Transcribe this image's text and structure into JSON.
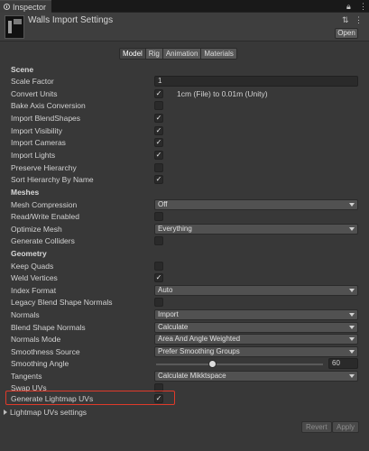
{
  "tab": {
    "label": "Inspector"
  },
  "header": {
    "title": "Walls Import Settings",
    "open_label": "Open"
  },
  "subtabs": [
    "Model",
    "Rig",
    "Animation",
    "Materials"
  ],
  "active_subtab": "Model",
  "scene": {
    "title": "Scene",
    "scale_factor_label": "Scale Factor",
    "scale_factor_value": "1",
    "convert_units_label": "Convert Units",
    "convert_units_checked": true,
    "convert_units_text": "1cm (File) to 0.01m (Unity)",
    "bake_axis_label": "Bake Axis Conversion",
    "bake_axis_checked": false,
    "import_blendshapes_label": "Import BlendShapes",
    "import_blendshapes_checked": true,
    "import_visibility_label": "Import Visibility",
    "import_visibility_checked": true,
    "import_cameras_label": "Import Cameras",
    "import_cameras_checked": true,
    "import_lights_label": "Import Lights",
    "import_lights_checked": true,
    "preserve_hierarchy_label": "Preserve Hierarchy",
    "preserve_hierarchy_checked": false,
    "sort_hierarchy_label": "Sort Hierarchy By Name",
    "sort_hierarchy_checked": true
  },
  "meshes": {
    "title": "Meshes",
    "mesh_compression_label": "Mesh Compression",
    "mesh_compression_value": "Off",
    "read_write_label": "Read/Write Enabled",
    "read_write_checked": false,
    "optimize_mesh_label": "Optimize Mesh",
    "optimize_mesh_value": "Everything",
    "generate_colliders_label": "Generate Colliders",
    "generate_colliders_checked": false
  },
  "geometry": {
    "title": "Geometry",
    "keep_quads_label": "Keep Quads",
    "keep_quads_checked": false,
    "weld_vertices_label": "Weld Vertices",
    "weld_vertices_checked": true,
    "index_format_label": "Index Format",
    "index_format_value": "Auto",
    "legacy_blend_label": "Legacy Blend Shape Normals",
    "legacy_blend_checked": false,
    "normals_label": "Normals",
    "normals_value": "Import",
    "blend_shape_normals_label": "Blend Shape Normals",
    "blend_shape_normals_value": "Calculate",
    "normals_mode_label": "Normals Mode",
    "normals_mode_value": "Area And Angle Weighted",
    "smoothness_source_label": "Smoothness Source",
    "smoothness_source_value": "Prefer Smoothing Groups",
    "smoothing_angle_label": "Smoothing Angle",
    "smoothing_angle_value": "60",
    "smoothing_angle_fraction": 0.333,
    "tangents_label": "Tangents",
    "tangents_value": "Calculate Mikktspace",
    "swap_uvs_label": "Swap UVs",
    "swap_uvs_checked": false,
    "generate_lightmap_label": "Generate Lightmap UVs",
    "generate_lightmap_checked": true,
    "lightmap_settings_label": "Lightmap UVs settings"
  },
  "footer": {
    "revert_label": "Revert",
    "apply_label": "Apply"
  },
  "colors": {
    "highlight": "#e03a2a",
    "background": "#383838"
  }
}
